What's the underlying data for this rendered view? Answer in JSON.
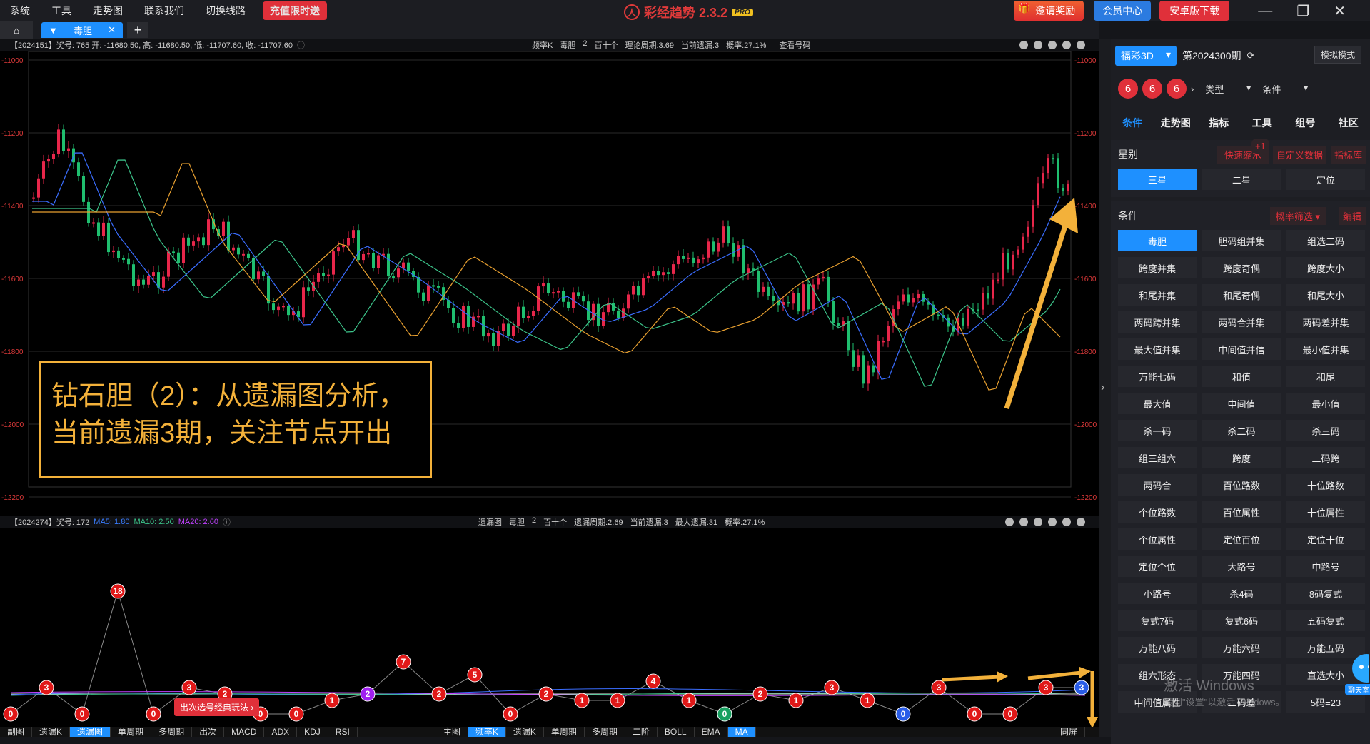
{
  "menu": {
    "items": [
      "系统",
      "工具",
      "走势图",
      "联系我们",
      "切换线路"
    ],
    "promo": "充值限时送"
  },
  "app": {
    "title": "彩经趋势 2.3.2",
    "badge": "PRO"
  },
  "top_right": {
    "invite": "邀请奖励",
    "member": "会员中心",
    "android": "安卓版下载"
  },
  "tab": {
    "label": "毒胆"
  },
  "main_info": {
    "left": "【2024151】奖号: 765  开: -11680.50, 高: -11680.50, 低: -11707.60, 收: -11707.60",
    "mid": [
      "频率K",
      "毒胆",
      "2",
      "百十个",
      "理论周期:3.69",
      "当前遗漏:3",
      "概率:27.1%",
      "查看号码"
    ],
    "y_ticks": [
      "-11000",
      "-11200",
      "-11400",
      "-11600",
      "-11800",
      "-12000",
      "-12200"
    ]
  },
  "sub_info": {
    "left": "【2024274】奖号: 172",
    "ma5": "MA5: 1.80",
    "ma10": "MA10: 2.50",
    "ma20": "MA20: 2.60",
    "mid": [
      "遗漏图",
      "毒胆",
      "2",
      "百十个",
      "遗漏周期:2.69",
      "当前遗漏:3",
      "最大遗漏:31",
      "概率:27.1%"
    ]
  },
  "annotation": {
    "line1": "钻石胆（2）：从遗漏图分析，",
    "line2": "当前遗漏3期，关注节点开出"
  },
  "promo_chip": "出次选号经典玩法 ›",
  "bottom_left_tabs": [
    "副图",
    "遗漏K",
    "遗漏图",
    "单周期",
    "多周期",
    "出次",
    "MACD",
    "ADX",
    "KDJ",
    "RSI"
  ],
  "bottom_mid_tabs": [
    "主图",
    "频率K",
    "遗漏K",
    "单周期",
    "多周期",
    "二阶",
    "BOLL",
    "EMA",
    "MA"
  ],
  "bottom_right": "同屏",
  "panel": {
    "lottery": "福彩3D",
    "period": "第2024300期",
    "mock": "模拟模式",
    "balls": [
      "6",
      "6",
      "6"
    ],
    "type_sel": "类型",
    "cond_sel": "条件",
    "tabs": [
      "条件",
      "走势图",
      "指标",
      "工具",
      "组号",
      "社区"
    ],
    "star_title": "星别",
    "star_links": [
      "快速缩水",
      "自定义数据",
      "指标库"
    ],
    "star_badge": "+1",
    "star_options": [
      "三星",
      "二星",
      "定位"
    ],
    "cond_title": "条件",
    "filter": "概率筛选",
    "edit": "编辑",
    "conditions": [
      "毒胆",
      "胆码组并集",
      "组选二码",
      "跨度并集",
      "跨度奇偶",
      "跨度大小",
      "和尾并集",
      "和尾奇偶",
      "和尾大小",
      "两码跨并集",
      "两码合并集",
      "两码差并集",
      "最大值并集",
      "中间值并信",
      "最小值并集",
      "万能七码",
      "和值",
      "和尾",
      "最大值",
      "中间值",
      "最小值",
      "杀一码",
      "杀二码",
      "杀三码",
      "组三组六",
      "跨度",
      "二码跨",
      "两码合",
      "百位路数",
      "十位路数",
      "个位路数",
      "百位属性",
      "十位属性",
      "个位属性",
      "定位百位",
      "定位十位",
      "定位个位",
      "大路号",
      "中路号",
      "小路号",
      "杀4码",
      "8码复式",
      "复式7码",
      "复式6码",
      "五码复式",
      "万能八码",
      "万能六码",
      "万能五码",
      "组六形态",
      "万能四码",
      "直选大小",
      "中间值属性",
      "二码差",
      "5码=23"
    ]
  },
  "watermark": {
    "line1": "激活 Windows",
    "line2": "转到\"设置\"以激活 Windows。"
  },
  "chat_label": "聊天室",
  "colors": {
    "accent": "#1e90ff",
    "red": "#e0303a",
    "annotation": "#f3b13a",
    "up": "#e8264a",
    "down": "#1fbf6f"
  },
  "sub_points": [
    {
      "v": "0",
      "c": "red"
    },
    {
      "v": "3",
      "c": "red"
    },
    {
      "v": "0",
      "c": "red"
    },
    {
      "v": "18",
      "c": "red"
    },
    {
      "v": "0",
      "c": "red"
    },
    {
      "v": "3",
      "c": "red"
    },
    {
      "v": "2",
      "c": "red"
    },
    {
      "v": "0",
      "c": "red"
    },
    {
      "v": "0",
      "c": "red"
    },
    {
      "v": "1",
      "c": "red"
    },
    {
      "v": "2",
      "c": "purple"
    },
    {
      "v": "7",
      "c": "red"
    },
    {
      "v": "2",
      "c": "red"
    },
    {
      "v": "5",
      "c": "red"
    },
    {
      "v": "0",
      "c": "red"
    },
    {
      "v": "2",
      "c": "red"
    },
    {
      "v": "1",
      "c": "red"
    },
    {
      "v": "1",
      "c": "red"
    },
    {
      "v": "4",
      "c": "red"
    },
    {
      "v": "1",
      "c": "red"
    },
    {
      "v": "0",
      "c": "green"
    },
    {
      "v": "2",
      "c": "red"
    },
    {
      "v": "1",
      "c": "red"
    },
    {
      "v": "3",
      "c": "red"
    },
    {
      "v": "1",
      "c": "red"
    },
    {
      "v": "0",
      "c": "blue"
    },
    {
      "v": "3",
      "c": "red"
    },
    {
      "v": "0",
      "c": "red"
    },
    {
      "v": "0",
      "c": "red"
    },
    {
      "v": "3",
      "c": "red"
    },
    {
      "v": "3",
      "c": "blue"
    }
  ]
}
